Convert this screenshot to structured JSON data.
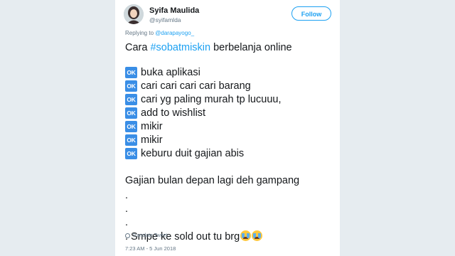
{
  "author": {
    "name": "Syifa Maulida",
    "handle": "@syifamlda",
    "follow_label": "Follow"
  },
  "reply": {
    "prefix": "Replying to",
    "target": "@darapayogo_"
  },
  "tweet": {
    "intro_prefix": "Cara ",
    "hashtag": "#sobatmiskin",
    "intro_suffix": " berbelanja online",
    "ok_badge": "OK",
    "ok_items": [
      "buka aplikasi",
      "cari cari cari cari barang",
      "cari yg paling murah tp lucuuu,",
      "add to wishlist",
      "mikir",
      "mikir",
      "keburu duit gajian abis"
    ],
    "line_gajian": "Gajian bulan depan lagi deh gampang",
    "dots": [
      ".",
      ".",
      "."
    ],
    "final_line": ". Smpe ke sold out tu brg",
    "emoji_count": 2,
    "emoji_name": "loudly-crying-face"
  },
  "translate_label": "Translate Tweet",
  "timestamp": "7:23 AM - 5 Jun 2018",
  "colors": {
    "accent": "#1da1f2",
    "ok_badge": "#3a8ee6",
    "text": "#14171a",
    "muted": "#657786"
  }
}
